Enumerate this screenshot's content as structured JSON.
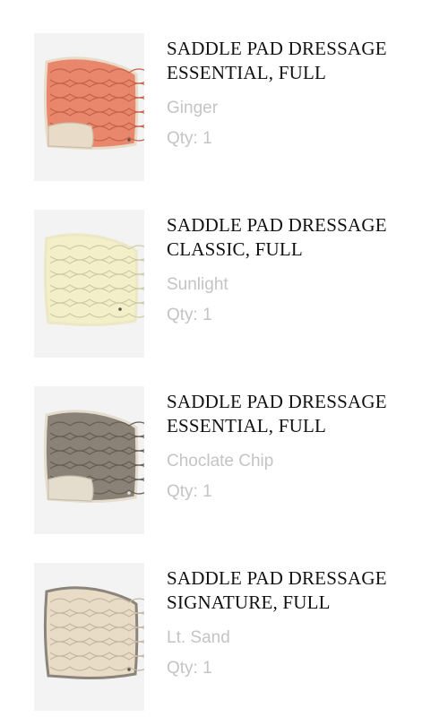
{
  "cart": {
    "items": [
      {
        "title_line1": "SADDLE PAD DRESSAGE",
        "title_line2": "ESSENTIAL, FULL",
        "color": "Ginger",
        "qty": "Qty: 1",
        "pad_color": "#e9876c",
        "trim_color": "#e8dcc8"
      },
      {
        "title_line1": "SADDLE PAD DRESSAGE",
        "title_line2": "CLASSIC, FULL",
        "color": "Sunlight",
        "qty": "Qty: 1",
        "pad_color": "#f2efc9",
        "trim_color": "#ece7c4"
      },
      {
        "title_line1": "SADDLE PAD DRESSAGE",
        "title_line2": "ESSENTIAL, FULL",
        "color": "Choclate Chip",
        "qty": "Qty: 1",
        "pad_color": "#8a8276",
        "trim_color": "#e4dccd"
      },
      {
        "title_line1": "SADDLE PAD DRESSAGE",
        "title_line2": "SIGNATURE, FULL",
        "color": "Lt. Sand",
        "qty": "Qty: 1",
        "pad_color": "#e9dcc7",
        "trim_color": "#8a847b"
      }
    ]
  }
}
